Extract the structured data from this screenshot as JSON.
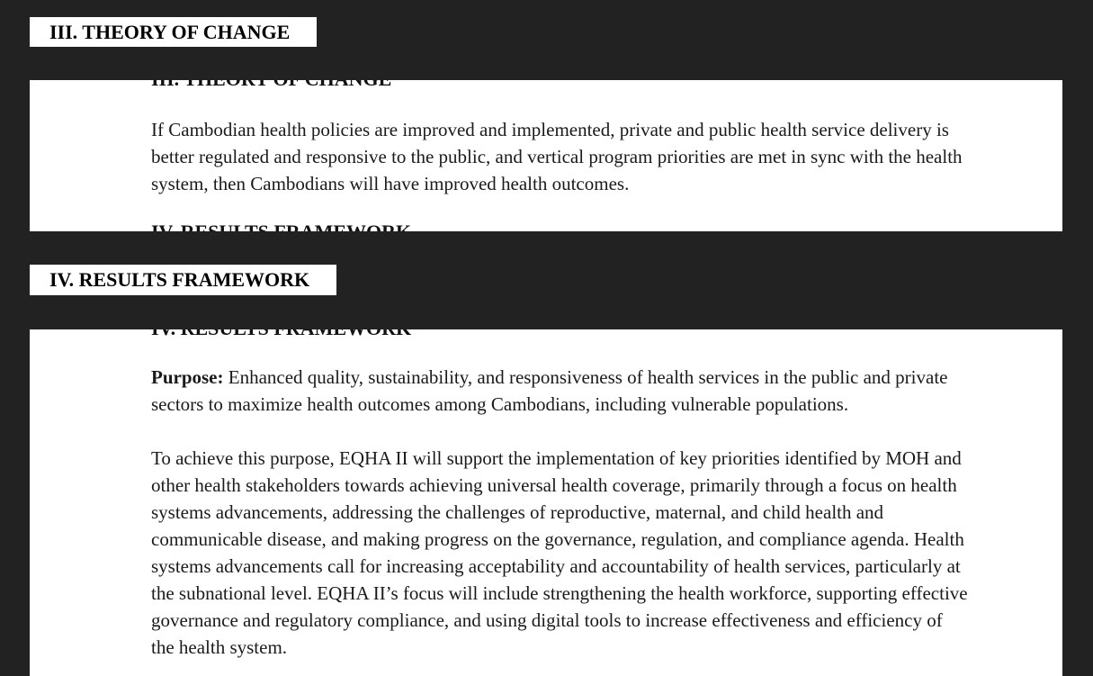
{
  "sections": [
    {
      "heading": "III. THEORY OF CHANGE",
      "paragraph": "If Cambodian health policies are improved and implemented, private and public health service delivery is better regulated and responsive to the public, and vertical program priorities are met in sync with the health system, then Cambodians will have improved health outcomes."
    },
    {
      "heading": "IV. RESULTS FRAMEWORK",
      "purpose_label": "Purpose:",
      "purpose_text": " Enhanced quality, sustainability, and responsiveness of health services in the public and private sectors to maximize health outcomes among Cambodians, including vulnerable populations.",
      "paragraph": "To achieve this purpose, EQHA II will support the implementation of key priorities identified by MOH and other health stakeholders towards achieving universal health coverage, primarily through a focus on health systems advancements, addressing the challenges of reproductive, maternal, and child health and communicable disease, and making progress on the governance, regulation, and compliance agenda. Health systems advancements call for increasing acceptability and accountability of health services, particularly at the subnational level. EQHA II’s focus will include strengthening the health workforce, supporting effective governance and regulatory compliance, and using digital tools to increase effectiveness and efficiency of the health system."
    }
  ]
}
